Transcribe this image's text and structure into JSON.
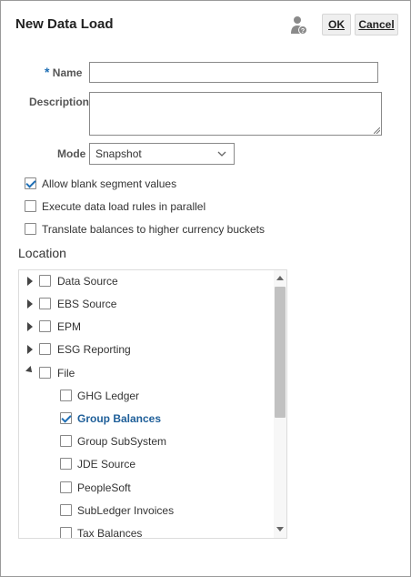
{
  "dialog": {
    "title": "New Data Load",
    "help_icon": "person-help-icon",
    "ok_label": "OK",
    "cancel_label": "Cancel"
  },
  "form": {
    "required_marker": "*",
    "name_label": "Name",
    "name_value": "",
    "description_label": "Description",
    "description_value": "",
    "mode_label": "Mode",
    "mode_value": "Snapshot"
  },
  "options": [
    {
      "label": "Allow blank segment values",
      "checked": true
    },
    {
      "label": "Execute data load rules in parallel",
      "checked": false
    },
    {
      "label": "Translate balances to higher currency buckets",
      "checked": false
    }
  ],
  "location": {
    "heading": "Location",
    "items": [
      {
        "label": "Data Source",
        "state": "collapsed",
        "checked": false,
        "level": 0
      },
      {
        "label": "EBS Source",
        "state": "collapsed",
        "checked": false,
        "level": 0
      },
      {
        "label": "EPM",
        "state": "collapsed",
        "checked": false,
        "level": 0
      },
      {
        "label": "ESG Reporting",
        "state": "collapsed",
        "checked": false,
        "level": 0
      },
      {
        "label": "File",
        "state": "expanded",
        "checked": false,
        "level": 0
      },
      {
        "label": "GHG Ledger",
        "state": "leaf",
        "checked": false,
        "level": 1
      },
      {
        "label": "Group Balances",
        "state": "leaf",
        "checked": true,
        "level": 1
      },
      {
        "label": "Group SubSystem",
        "state": "leaf",
        "checked": false,
        "level": 1
      },
      {
        "label": "JDE Source",
        "state": "leaf",
        "checked": false,
        "level": 1
      },
      {
        "label": "PeopleSoft",
        "state": "leaf",
        "checked": false,
        "level": 1
      },
      {
        "label": "SubLedger Invoices",
        "state": "leaf",
        "checked": false,
        "level": 1
      },
      {
        "label": "Tax Balances",
        "state": "leaf",
        "checked": false,
        "level": 1
      }
    ]
  },
  "colors": {
    "accent": "#1f6fb5",
    "selected_text": "#1f5f99"
  }
}
